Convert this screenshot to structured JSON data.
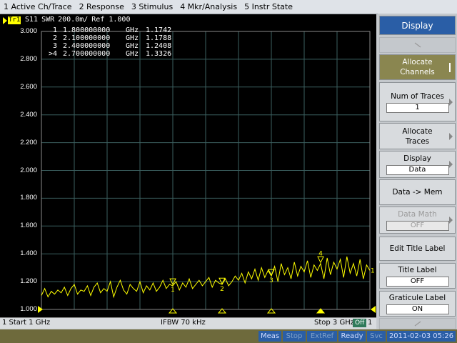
{
  "menu": [
    "1 Active Ch/Trace",
    "2 Response",
    "3 Stimulus",
    "4 Mkr/Analysis",
    "5 Instr State"
  ],
  "trace": {
    "tag": "Tr1",
    "parameter": "S11",
    "format": "SWR",
    "scale": "200.0m/",
    "ref": "Ref 1.000",
    "color": "#ffff00"
  },
  "markers": [
    {
      "id": "1",
      "freq": "1.800000000",
      "unit": "GHz",
      "value": "1.1742"
    },
    {
      "id": "2",
      "freq": "2.100000000",
      "unit": "GHz",
      "value": "1.1788"
    },
    {
      "id": "3",
      "freq": "2.400000000",
      "unit": "GHz",
      "value": "1.2408"
    },
    {
      "id": ">4",
      "freq": "2.700000000",
      "unit": "GHz",
      "value": "1.3326"
    }
  ],
  "y_axis_labels": [
    "3.000",
    "2.800",
    "2.600",
    "2.400",
    "2.200",
    "2.000",
    "1.800",
    "1.600",
    "1.400",
    "1.200",
    "1.000"
  ],
  "chart_data": {
    "type": "line",
    "x_start_ghz": 1,
    "x_stop_ghz": 3,
    "ylim": [
      1.0,
      3.0
    ],
    "grid": true,
    "series": [
      {
        "name": "S11",
        "x": [
          1.0,
          1.02,
          1.04,
          1.06,
          1.08,
          1.1,
          1.12,
          1.14,
          1.16,
          1.18,
          1.2,
          1.22,
          1.24,
          1.26,
          1.28,
          1.3,
          1.32,
          1.34,
          1.36,
          1.38,
          1.4,
          1.42,
          1.44,
          1.46,
          1.48,
          1.5,
          1.52,
          1.54,
          1.56,
          1.58,
          1.6,
          1.62,
          1.64,
          1.66,
          1.68,
          1.7,
          1.72,
          1.74,
          1.76,
          1.78,
          1.8,
          1.82,
          1.84,
          1.86,
          1.88,
          1.9,
          1.92,
          1.94,
          1.96,
          1.98,
          2.0,
          2.02,
          2.04,
          2.06,
          2.08,
          2.1,
          2.12,
          2.14,
          2.16,
          2.18,
          2.2,
          2.22,
          2.24,
          2.26,
          2.28,
          2.3,
          2.32,
          2.34,
          2.36,
          2.38,
          2.4,
          2.42,
          2.44,
          2.46,
          2.48,
          2.5,
          2.52,
          2.54,
          2.56,
          2.58,
          2.6,
          2.62,
          2.64,
          2.66,
          2.68,
          2.7,
          2.72,
          2.74,
          2.76,
          2.78,
          2.8,
          2.82,
          2.84,
          2.86,
          2.88,
          2.9,
          2.92,
          2.94,
          2.96,
          2.98,
          3.0
        ],
        "y": [
          1.1,
          1.15,
          1.09,
          1.13,
          1.11,
          1.14,
          1.12,
          1.16,
          1.1,
          1.15,
          1.18,
          1.11,
          1.14,
          1.13,
          1.17,
          1.1,
          1.16,
          1.19,
          1.12,
          1.15,
          1.13,
          1.2,
          1.09,
          1.16,
          1.21,
          1.14,
          1.11,
          1.18,
          1.15,
          1.13,
          1.2,
          1.12,
          1.17,
          1.14,
          1.19,
          1.13,
          1.16,
          1.21,
          1.15,
          1.18,
          1.17,
          1.2,
          1.14,
          1.19,
          1.16,
          1.22,
          1.15,
          1.18,
          1.21,
          1.17,
          1.2,
          1.23,
          1.16,
          1.21,
          1.19,
          1.18,
          1.22,
          1.17,
          1.2,
          1.24,
          1.21,
          1.26,
          1.19,
          1.27,
          1.22,
          1.29,
          1.21,
          1.3,
          1.23,
          1.28,
          1.24,
          1.31,
          1.2,
          1.33,
          1.25,
          1.3,
          1.22,
          1.34,
          1.24,
          1.31,
          1.27,
          1.35,
          1.23,
          1.32,
          1.28,
          1.33,
          1.22,
          1.37,
          1.25,
          1.34,
          1.29,
          1.36,
          1.23,
          1.38,
          1.26,
          1.33,
          1.24,
          1.36,
          1.22,
          1.32,
          1.28
        ],
        "markers_x": [
          1.8,
          2.1,
          2.4,
          2.7
        ],
        "markers_y": [
          1.1742,
          1.1788,
          1.2408,
          1.3326
        ]
      }
    ]
  },
  "footer": {
    "start": "1  Start 1 GHz",
    "ifbw": "IFBW 70 kHz",
    "stop": "Stop 3 GHz",
    "output": "Off",
    "ch": "1"
  },
  "status": [
    "Meas",
    "Stop",
    "ExtRef",
    "Ready",
    "Svc",
    "2011-02-03 05:26"
  ],
  "softkeys": {
    "title": "Display",
    "allocate_channels": "Allocate Channels",
    "num_traces_label": "Num of Traces",
    "num_traces_value": "1",
    "allocate_traces": "Allocate Traces",
    "display_label": "Display",
    "display_value": "Data",
    "data_to_mem": "Data -> Mem",
    "data_math_label": "Data Math",
    "data_math_value": "OFF",
    "edit_title": "Edit Title Label",
    "title_label": "Title Label",
    "title_label_value": "OFF",
    "graticule_label": "Graticule Label",
    "graticule_label_value": "ON"
  },
  "colors": {
    "accent": "#2a5ea6",
    "allocate_channels_bg": "#8a8650",
    "trace": "#ffff00"
  }
}
